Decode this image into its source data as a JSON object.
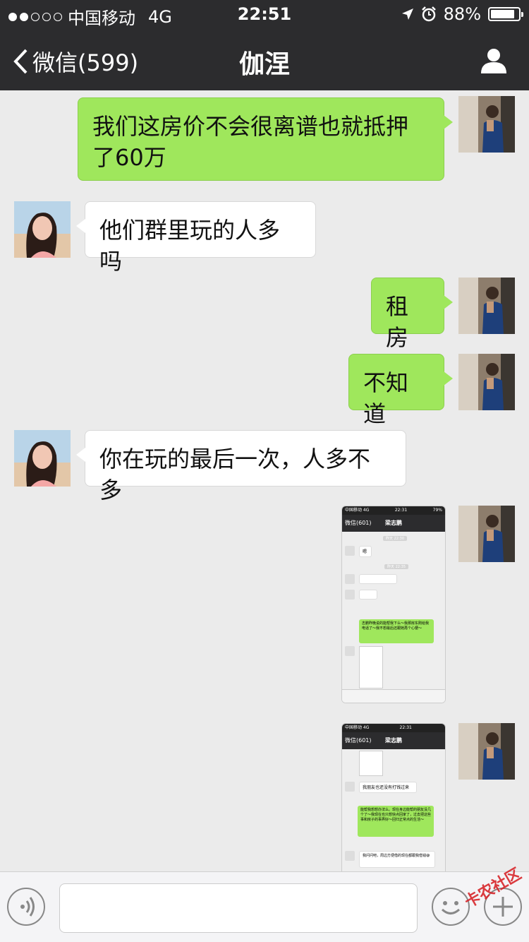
{
  "status_bar": {
    "carrier": "中国移动",
    "network": "4G",
    "time": "22:51",
    "battery": "88%",
    "battery_level": 0.88
  },
  "nav": {
    "back_label": "微信(599)",
    "title": "伽涅"
  },
  "messages": [
    {
      "sender": "me",
      "text": "我们这房价不会很离谱也就抵押了60万"
    },
    {
      "sender": "them",
      "text": "他们群里玩的人多吗"
    },
    {
      "sender": "me",
      "text": "租房"
    },
    {
      "sender": "me",
      "text": "不知道"
    },
    {
      "sender": "them",
      "text": "你在玩的最后一次，人多不多"
    }
  ],
  "screenshot_1": {
    "status_carrier": "中国移动 4G",
    "status_time": "22:31",
    "status_battery": "79%",
    "back": "微信(601)",
    "title": "梁志鹏",
    "msg_1": "嗯",
    "msg_2": "志鹏昨晚说的能帮我下么～我那房东刚给我电话了～我不想最后还跟她再个心梗～",
    "time_label_1": "昨天 22:30",
    "time_label_2": "昨天 22:35"
  },
  "screenshot_2": {
    "status_carrier": "中国移动 4G",
    "status_time": "22:31",
    "back": "微信(601)",
    "title": "梁志鹏",
    "msg_1": "我朋友也还没有打钱过来",
    "msg_2": "能帮我想想办法么。现在身边能帮的朋友没几个了～我现在也只想快点回家了，过去把这些事和房子的事弄好～回归正常点的生活～",
    "msg_3": "我问问吧，周边方便借的现在都跟我借钱😅"
  },
  "watermark": "卡农社区"
}
